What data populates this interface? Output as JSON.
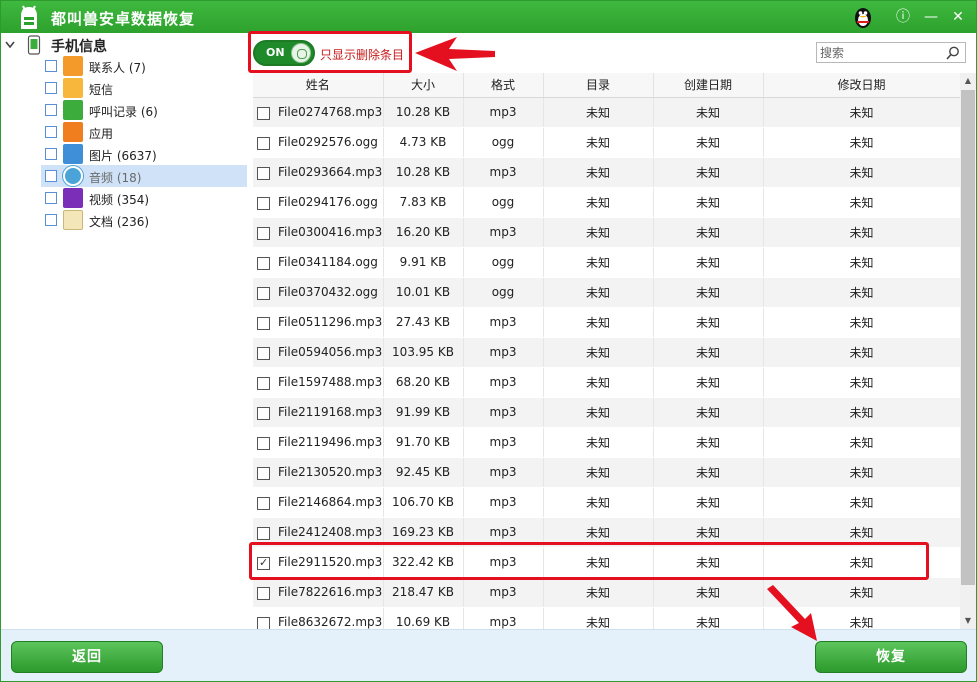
{
  "app": {
    "title": "都叫兽安卓数据恢复",
    "colors": {
      "brand_green": "#2da12d",
      "annotation_red": "#e4101f",
      "selection_blue": "#cfe2f7"
    }
  },
  "titlebar": {
    "qq_icon": "qq-penguin-icon",
    "info_glyph": "ⓘ",
    "minimize_glyph": "—",
    "close_glyph": "✕"
  },
  "sidebar": {
    "root_label": "手机信息",
    "items": [
      {
        "label": "联系人 (7)",
        "icon": "contacts-icon",
        "color": "#f39a2b",
        "selected": false
      },
      {
        "label": "短信",
        "icon": "sms-icon",
        "color": "#f6b73c",
        "selected": false
      },
      {
        "label": "呼叫记录 (6)",
        "icon": "call-log-icon",
        "color": "#3cac3c",
        "selected": false
      },
      {
        "label": "应用",
        "icon": "apps-icon",
        "color": "#f07e1e",
        "selected": false
      },
      {
        "label": "图片 (6637)",
        "icon": "pictures-icon",
        "color": "#3f8fd8",
        "selected": false
      },
      {
        "label": "音频 (18)",
        "icon": "audio-icon",
        "color": "#4aa4d8",
        "selected": true
      },
      {
        "label": "视频 (354)",
        "icon": "video-icon",
        "color": "#7b2fb8",
        "selected": false
      },
      {
        "label": "文档 (236)",
        "icon": "document-icon",
        "color": "#f3e6b8",
        "selected": false
      }
    ]
  },
  "filter": {
    "toggle_state": "ON",
    "toggle_label": "只显示删除条目"
  },
  "search": {
    "placeholder": "搜索"
  },
  "table": {
    "columns": [
      "姓名",
      "大小",
      "格式",
      "目录",
      "创建日期",
      "修改日期"
    ],
    "rows": [
      {
        "name": "File0274768.mp3",
        "size": "10.28 KB",
        "format": "mp3",
        "dir": "未知",
        "created": "未知",
        "modified": "未知",
        "checked": false
      },
      {
        "name": "File0292576.ogg",
        "size": "4.73 KB",
        "format": "ogg",
        "dir": "未知",
        "created": "未知",
        "modified": "未知",
        "checked": false
      },
      {
        "name": "File0293664.mp3",
        "size": "10.28 KB",
        "format": "mp3",
        "dir": "未知",
        "created": "未知",
        "modified": "未知",
        "checked": false
      },
      {
        "name": "File0294176.ogg",
        "size": "7.83 KB",
        "format": "ogg",
        "dir": "未知",
        "created": "未知",
        "modified": "未知",
        "checked": false
      },
      {
        "name": "File0300416.mp3",
        "size": "16.20 KB",
        "format": "mp3",
        "dir": "未知",
        "created": "未知",
        "modified": "未知",
        "checked": false
      },
      {
        "name": "File0341184.ogg",
        "size": "9.91 KB",
        "format": "ogg",
        "dir": "未知",
        "created": "未知",
        "modified": "未知",
        "checked": false
      },
      {
        "name": "File0370432.ogg",
        "size": "10.01 KB",
        "format": "ogg",
        "dir": "未知",
        "created": "未知",
        "modified": "未知",
        "checked": false
      },
      {
        "name": "File0511296.mp3",
        "size": "27.43 KB",
        "format": "mp3",
        "dir": "未知",
        "created": "未知",
        "modified": "未知",
        "checked": false
      },
      {
        "name": "File0594056.mp3",
        "size": "103.95 KB",
        "format": "mp3",
        "dir": "未知",
        "created": "未知",
        "modified": "未知",
        "checked": false
      },
      {
        "name": "File1597488.mp3",
        "size": "68.20 KB",
        "format": "mp3",
        "dir": "未知",
        "created": "未知",
        "modified": "未知",
        "checked": false
      },
      {
        "name": "File2119168.mp3",
        "size": "91.99 KB",
        "format": "mp3",
        "dir": "未知",
        "created": "未知",
        "modified": "未知",
        "checked": false
      },
      {
        "name": "File2119496.mp3",
        "size": "91.70 KB",
        "format": "mp3",
        "dir": "未知",
        "created": "未知",
        "modified": "未知",
        "checked": false
      },
      {
        "name": "File2130520.mp3",
        "size": "92.45 KB",
        "format": "mp3",
        "dir": "未知",
        "created": "未知",
        "modified": "未知",
        "checked": false
      },
      {
        "name": "File2146864.mp3",
        "size": "106.70 KB",
        "format": "mp3",
        "dir": "未知",
        "created": "未知",
        "modified": "未知",
        "checked": false
      },
      {
        "name": "File2412408.mp3",
        "size": "169.23 KB",
        "format": "mp3",
        "dir": "未知",
        "created": "未知",
        "modified": "未知",
        "checked": false
      },
      {
        "name": "File2911520.mp3",
        "size": "322.42 KB",
        "format": "mp3",
        "dir": "未知",
        "created": "未知",
        "modified": "未知",
        "checked": true
      },
      {
        "name": "File7822616.mp3",
        "size": "218.47 KB",
        "format": "mp3",
        "dir": "未知",
        "created": "未知",
        "modified": "未知",
        "checked": false
      },
      {
        "name": "File8632672.mp3",
        "size": "10.69 KB",
        "format": "mp3",
        "dir": "未知",
        "created": "未知",
        "modified": "未知",
        "checked": false
      }
    ]
  },
  "footer": {
    "back_label": "返回",
    "recover_label": "恢复"
  }
}
